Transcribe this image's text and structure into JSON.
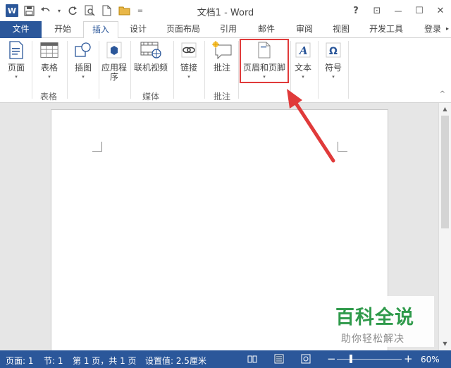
{
  "title_bar": {
    "title": "文档1 - Word",
    "help": "?",
    "restore_ribbon": "⊡",
    "minimize": "—",
    "maximize": "☐",
    "close": "✕"
  },
  "qat": {
    "app_letter": "W",
    "customize": "="
  },
  "tabs": [
    {
      "label": "文件"
    },
    {
      "label": "开始"
    },
    {
      "label": "插入"
    },
    {
      "label": "设计"
    },
    {
      "label": "页面布局"
    },
    {
      "label": "引用"
    },
    {
      "label": "邮件"
    },
    {
      "label": "审阅"
    },
    {
      "label": "视图"
    },
    {
      "label": "开发工具"
    },
    {
      "label": "登录"
    }
  ],
  "ribbon": {
    "buttons": [
      {
        "label": "页面"
      },
      {
        "label": "表格"
      },
      {
        "label": "插图"
      },
      {
        "label": "应用程序"
      },
      {
        "label": "联机视频"
      },
      {
        "label": "链接"
      },
      {
        "label": "批注"
      },
      {
        "label": "页眉和页脚"
      },
      {
        "label": "文本"
      },
      {
        "label": "符号"
      }
    ],
    "groups": [
      {
        "label": "表格"
      },
      {
        "label": "媒体"
      },
      {
        "label": "批注"
      }
    ],
    "caret": "▾",
    "collapse": "^"
  },
  "watermark": {
    "title": "百科全说",
    "subtitle": "助你轻松解决"
  },
  "status": {
    "page": "页面: 1",
    "section": "节: 1",
    "pages": "第 1 页，共 1 页",
    "setting": "设置值: 2.5厘米",
    "zoom": "60%",
    "zoom_level": 0.6
  },
  "colors": {
    "accent": "#2b579a",
    "highlight": "#e03a3a",
    "watermark": "#2f9a4b"
  }
}
